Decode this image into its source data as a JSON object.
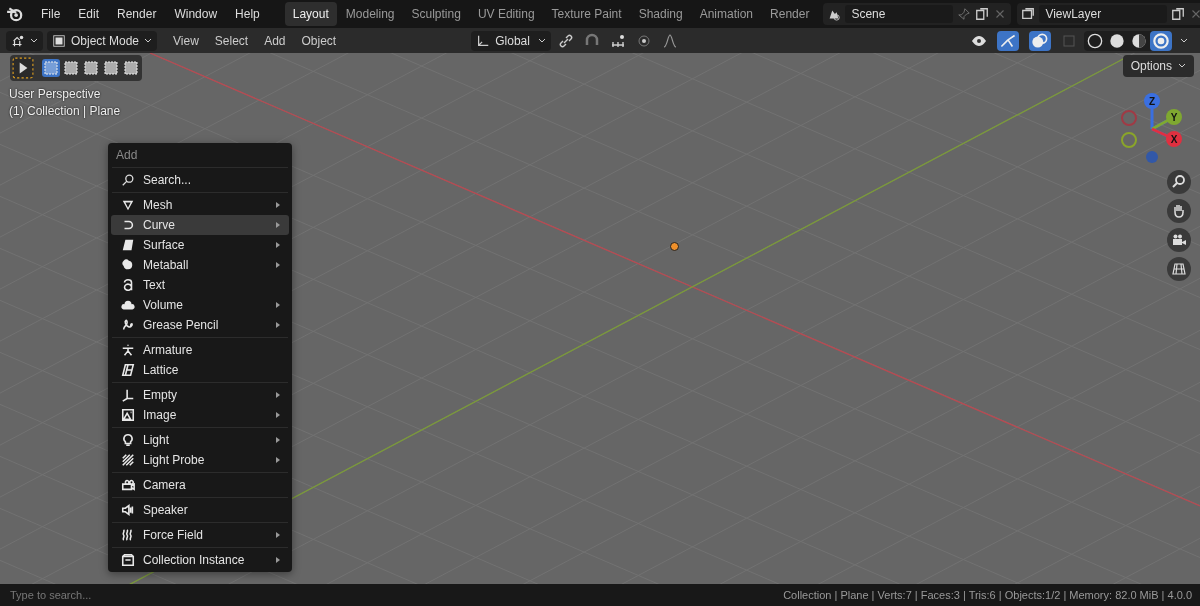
{
  "top_menu": [
    "File",
    "Edit",
    "Render",
    "Window",
    "Help"
  ],
  "workspace_tabs": [
    {
      "label": "Layout",
      "selected": true
    },
    {
      "label": "Modeling",
      "selected": false
    },
    {
      "label": "Sculpting",
      "selected": false
    },
    {
      "label": "UV Editing",
      "selected": false
    },
    {
      "label": "Texture Paint",
      "selected": false
    },
    {
      "label": "Shading",
      "selected": false
    },
    {
      "label": "Animation",
      "selected": false
    },
    {
      "label": "Render",
      "selected": false
    }
  ],
  "scene": {
    "value": "Scene"
  },
  "view_layer": {
    "value": "ViewLayer"
  },
  "header": {
    "mode": "Object Mode",
    "menus": [
      "View",
      "Select",
      "Add",
      "Object"
    ],
    "orientation": "Global",
    "gizmos_on": true,
    "overlays_on": true,
    "shading_modes": [
      {
        "selected": false
      },
      {
        "selected": false
      },
      {
        "selected": false
      },
      {
        "selected": true
      }
    ]
  },
  "select_modes": [
    {
      "selected": true
    },
    {
      "selected": false
    },
    {
      "selected": false
    },
    {
      "selected": false
    },
    {
      "selected": false
    }
  ],
  "viewport": {
    "view_name": "User Perspective",
    "context": "(1) Collection | Plane",
    "options_label": "Options",
    "axes": [
      {
        "label": "Z"
      },
      {
        "label": "Y"
      },
      {
        "label": "X"
      }
    ]
  },
  "add_menu": {
    "title": "Add",
    "search_label": "Search...",
    "groups": [
      [
        {
          "label": "Mesh",
          "submenu": true,
          "selected": false
        },
        {
          "label": "Curve",
          "submenu": true,
          "selected": true
        },
        {
          "label": "Surface",
          "submenu": true,
          "selected": false
        },
        {
          "label": "Metaball",
          "submenu": true,
          "selected": false
        },
        {
          "label": "Text",
          "submenu": false,
          "selected": false
        },
        {
          "label": "Volume",
          "submenu": true,
          "selected": false
        },
        {
          "label": "Grease Pencil",
          "submenu": true,
          "selected": false
        }
      ],
      [
        {
          "label": "Armature",
          "submenu": false,
          "selected": false
        },
        {
          "label": "Lattice",
          "submenu": false,
          "selected": false
        }
      ],
      [
        {
          "label": "Empty",
          "submenu": true,
          "selected": false
        },
        {
          "label": "Image",
          "submenu": true,
          "selected": false
        }
      ],
      [
        {
          "label": "Light",
          "submenu": true,
          "selected": false
        },
        {
          "label": "Light Probe",
          "submenu": true,
          "selected": false
        }
      ],
      [
        {
          "label": "Camera",
          "submenu": false,
          "selected": false
        }
      ],
      [
        {
          "label": "Speaker",
          "submenu": false,
          "selected": false
        }
      ],
      [
        {
          "label": "Force Field",
          "submenu": true,
          "selected": false
        }
      ],
      [
        {
          "label": "Collection Instance",
          "submenu": true,
          "selected": false
        }
      ]
    ]
  },
  "status_bar": {
    "search_placeholder": "Type to search...",
    "stats": "Collection | Plane | Verts:7 | Faces:3 | Tris:6 | Objects:1/2 | Memory: 82.0 MiB | 4.0.0"
  }
}
